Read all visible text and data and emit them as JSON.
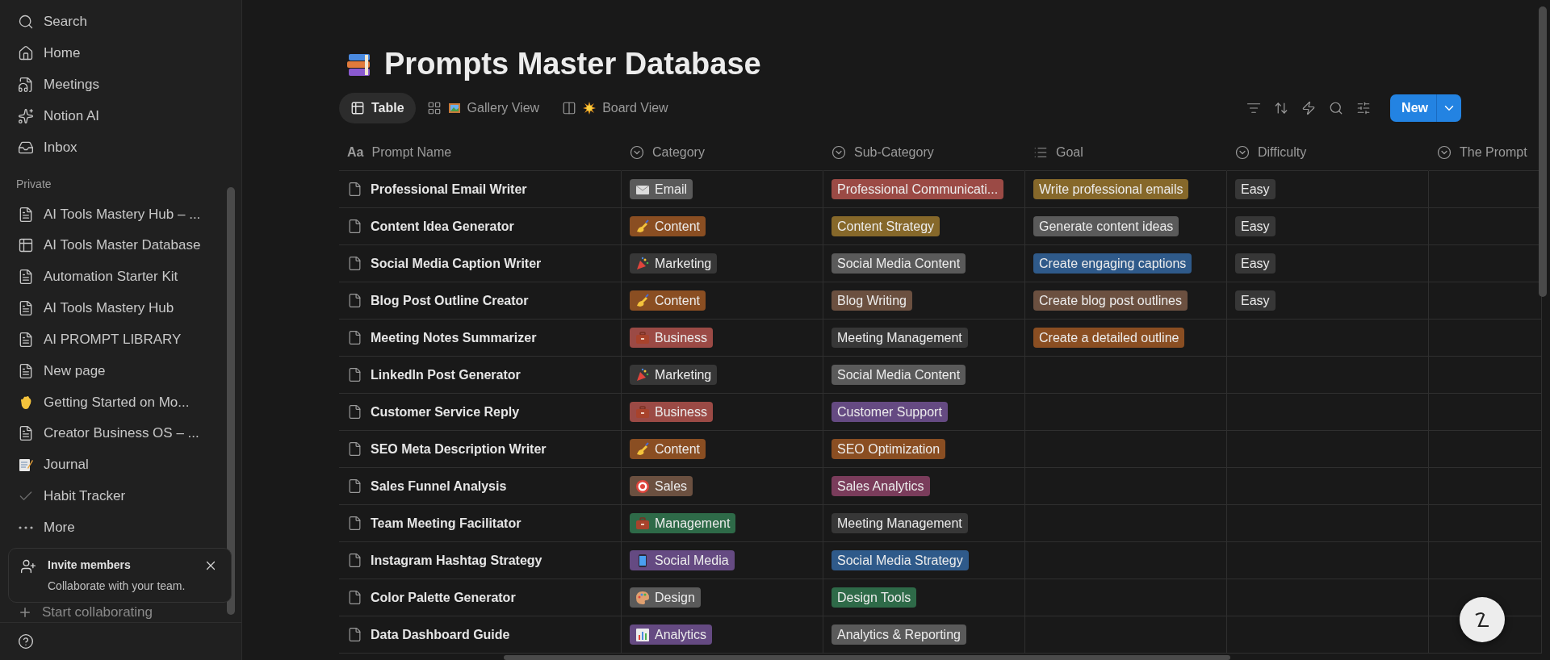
{
  "sidebar": {
    "nav": [
      {
        "label": "Search",
        "kind": "search"
      },
      {
        "label": "Home",
        "kind": "home"
      },
      {
        "label": "Meetings",
        "kind": "meetings"
      },
      {
        "label": "Notion AI",
        "kind": "ai"
      },
      {
        "label": "Inbox",
        "kind": "inbox"
      }
    ],
    "section": "Private",
    "pages": [
      {
        "label": "AI Tools Mastery Hub – ...",
        "kind": "page"
      },
      {
        "label": "AI Tools Master Database",
        "kind": "table"
      },
      {
        "label": "Automation Starter Kit",
        "kind": "page"
      },
      {
        "label": "AI Tools Mastery Hub",
        "kind": "page"
      },
      {
        "label": "AI PROMPT LIBRARY",
        "kind": "page"
      },
      {
        "label": "New page",
        "kind": "page"
      },
      {
        "label": "Getting Started on Mo...",
        "kind": "wave"
      },
      {
        "label": "Creator Business OS – ...",
        "kind": "page"
      },
      {
        "label": "Journal",
        "kind": "memo"
      },
      {
        "label": "Habit Tracker",
        "kind": "check"
      },
      {
        "label": "More",
        "kind": "more"
      }
    ],
    "invite": {
      "title": "Invite members",
      "text": "Collaborate with your team."
    },
    "start": "Start collaborating"
  },
  "title": "Prompts Master Database",
  "views": [
    {
      "label": "Table",
      "kind": "table",
      "selected": true
    },
    {
      "label": "Gallery View",
      "kind": "gallery",
      "selected": false
    },
    {
      "label": "Board View",
      "kind": "board",
      "selected": false
    }
  ],
  "new_button": "New",
  "table": {
    "columns": [
      {
        "label": "Prompt Name",
        "kind": "title",
        "glyph": "Aa"
      },
      {
        "label": "Category",
        "kind": "select"
      },
      {
        "label": "Sub-Category",
        "kind": "select"
      },
      {
        "label": "Goal",
        "kind": "multi"
      },
      {
        "label": "Difficulty",
        "kind": "select"
      },
      {
        "label": "The Prompt",
        "kind": "select"
      }
    ],
    "rows": [
      {
        "name": "Professional Email Writer",
        "category": {
          "label": "Email",
          "kind": "mail",
          "color": "#5a5a5a"
        },
        "sub": {
          "label": "Professional Communicati...",
          "color": "#9b4a45"
        },
        "goal": {
          "label": "Write professional emails",
          "color": "#86682a"
        },
        "difficulty": {
          "label": "Easy",
          "color": "#373737"
        }
      },
      {
        "name": "Content Idea Generator",
        "category": {
          "label": "Content",
          "kind": "pen",
          "color": "#8a4e22"
        },
        "sub": {
          "label": "Content Strategy",
          "color": "#86682a"
        },
        "goal": {
          "label": "Generate content ideas",
          "color": "#5a5a5a"
        },
        "difficulty": {
          "label": "Easy",
          "color": "#373737"
        }
      },
      {
        "name": "Social Media Caption Writer",
        "category": {
          "label": "Marketing",
          "kind": "party",
          "color": "#373737"
        },
        "sub": {
          "label": "Social Media Content",
          "color": "#5a5a5a"
        },
        "goal": {
          "label": "Create engaging captions",
          "color": "#2f5a8a"
        },
        "difficulty": {
          "label": "Easy",
          "color": "#373737"
        }
      },
      {
        "name": "Blog Post Outline Creator",
        "category": {
          "label": "Content",
          "kind": "pen",
          "color": "#8a4e22"
        },
        "sub": {
          "label": "Blog Writing",
          "color": "#6b5040"
        },
        "goal": {
          "label": "Create blog post outlines",
          "color": "#6b5040"
        },
        "difficulty": {
          "label": "Easy",
          "color": "#373737"
        }
      },
      {
        "name": "Meeting Notes Summarizer",
        "category": {
          "label": "Business",
          "kind": "briefcase",
          "color": "#9b4a45"
        },
        "sub": {
          "label": "Meeting Management",
          "color": "#373737"
        },
        "goal": {
          "label": "Create a detailed outline",
          "color": "#8a4e22"
        }
      },
      {
        "name": "LinkedIn Post Generator",
        "category": {
          "label": "Marketing",
          "kind": "party",
          "color": "#373737"
        },
        "sub": {
          "label": "Social Media Content",
          "color": "#5a5a5a"
        }
      },
      {
        "name": "Customer Service Reply",
        "category": {
          "label": "Business",
          "kind": "briefcase",
          "color": "#9b4a45"
        },
        "sub": {
          "label": "Customer Support",
          "color": "#654a82"
        }
      },
      {
        "name": "SEO Meta Description Writer",
        "category": {
          "label": "Content",
          "kind": "pen",
          "color": "#8a4e22"
        },
        "sub": {
          "label": "SEO Optimization",
          "color": "#8a4e22"
        }
      },
      {
        "name": "Sales Funnel Analysis",
        "category": {
          "label": "Sales",
          "kind": "target",
          "color": "#6b5040"
        },
        "sub": {
          "label": "Sales Analytics",
          "color": "#7a3c5b"
        }
      },
      {
        "name": "Team Meeting Facilitator",
        "category": {
          "label": "Management",
          "kind": "briefcase",
          "color": "#2e6a48"
        },
        "sub": {
          "label": "Meeting Management",
          "color": "#373737"
        }
      },
      {
        "name": "Instagram Hashtag Strategy",
        "category": {
          "label": "Social Media",
          "kind": "phone",
          "color": "#654a82"
        },
        "sub": {
          "label": "Social Media Strategy",
          "color": "#2f5a8a"
        }
      },
      {
        "name": "Color Palette Generator",
        "category": {
          "label": "Design",
          "kind": "palette",
          "color": "#5a5a5a"
        },
        "sub": {
          "label": "Design Tools",
          "color": "#2e6a48"
        }
      },
      {
        "name": "Data Dashboard Guide",
        "category": {
          "label": "Analytics",
          "kind": "chart",
          "color": "#654a82"
        },
        "sub": {
          "label": "Analytics & Reporting",
          "color": "#5a5a5a"
        }
      }
    ]
  }
}
